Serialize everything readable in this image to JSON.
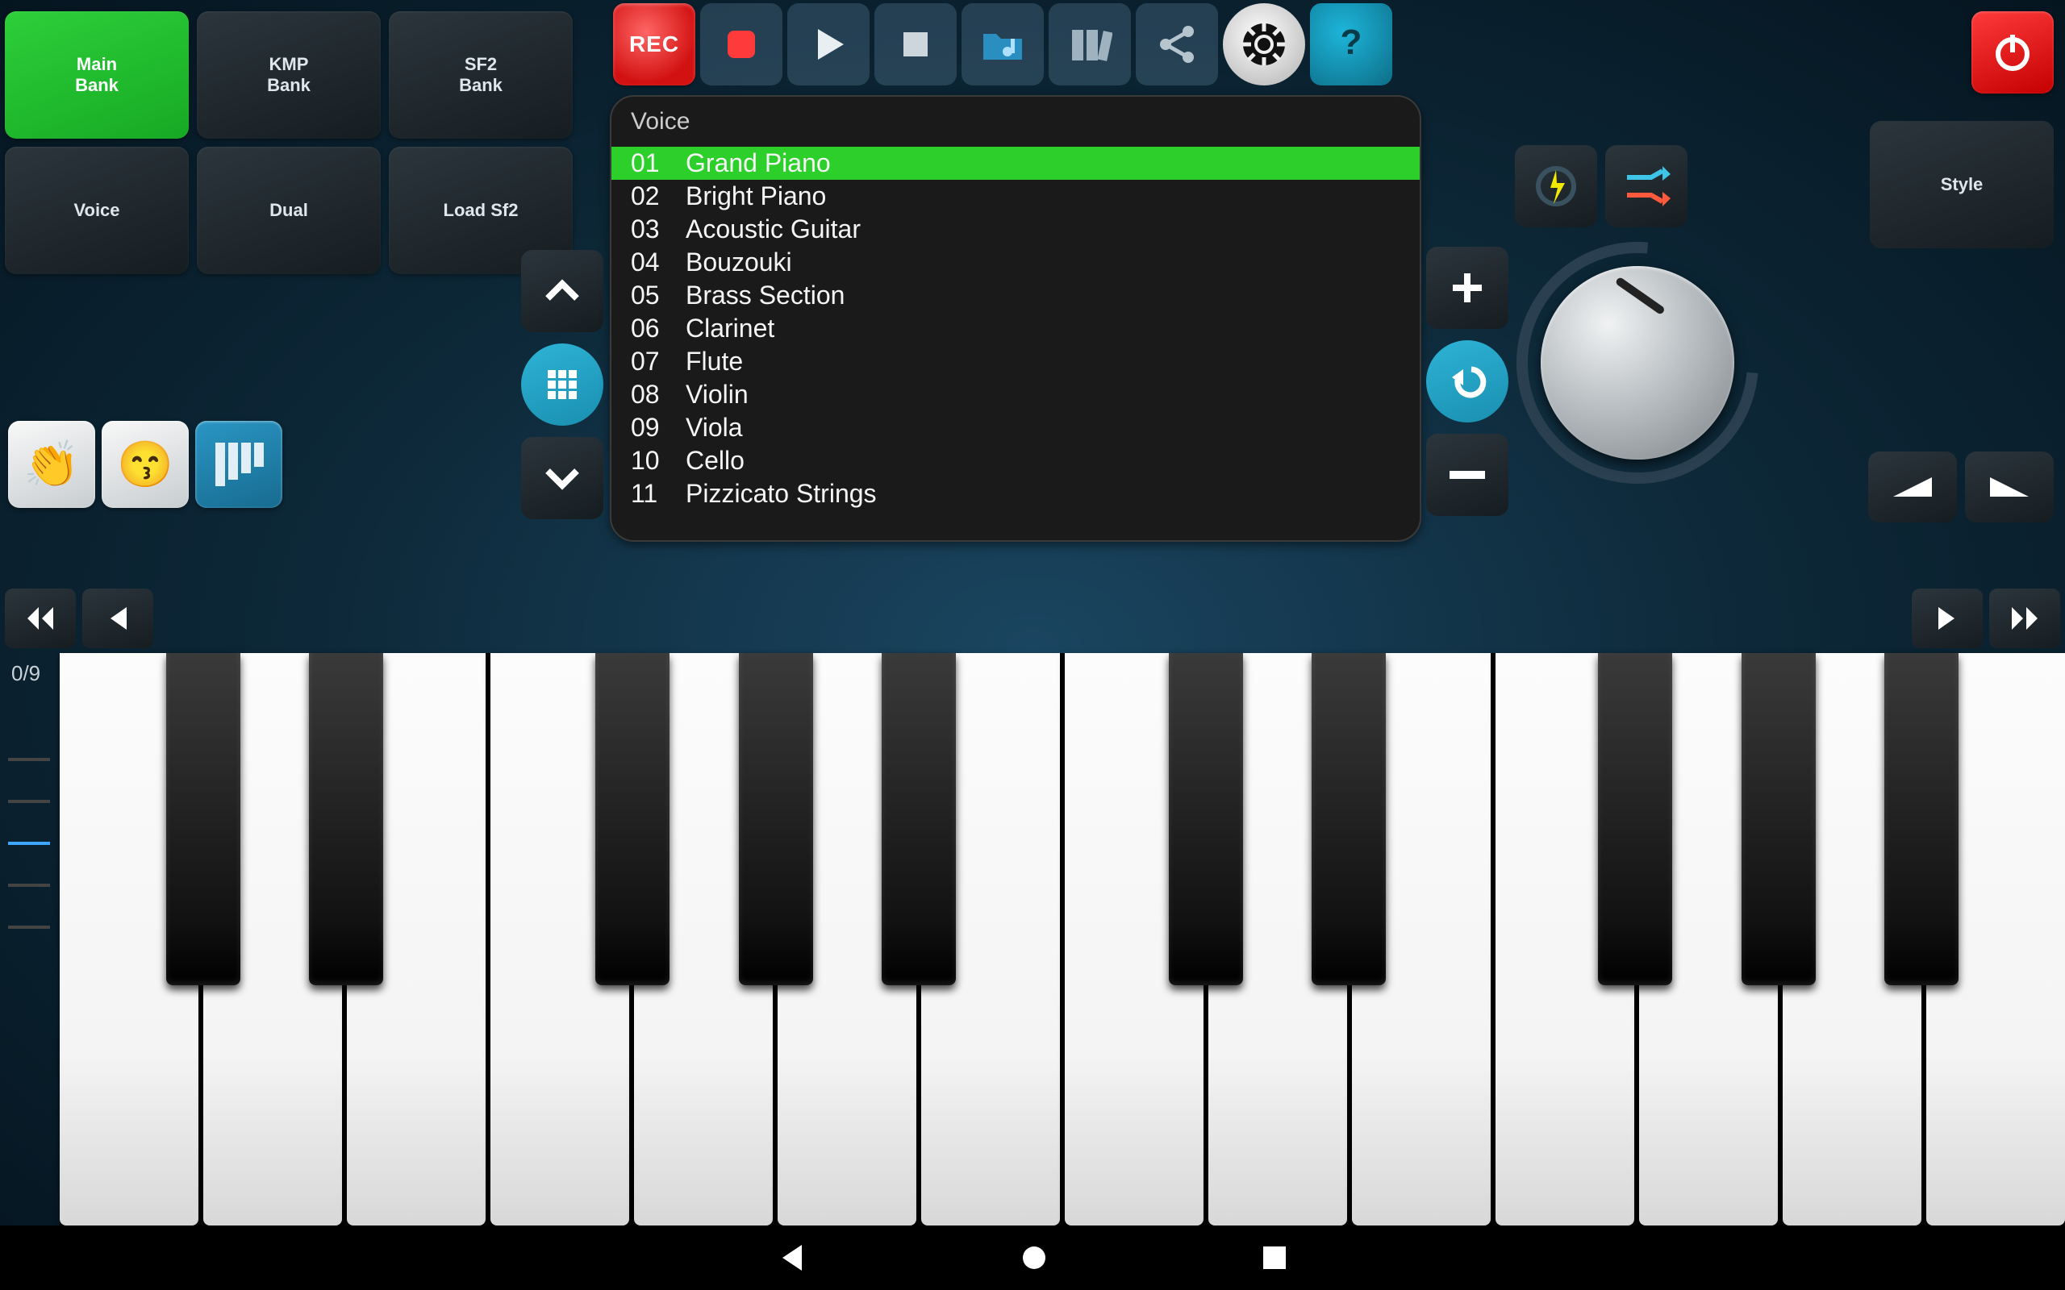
{
  "banks": [
    {
      "label": "Main\nBank",
      "active": true
    },
    {
      "label": "KMP\nBank",
      "active": false
    },
    {
      "label": "SF2\nBank",
      "active": false
    },
    {
      "label": "Voice",
      "active": false
    },
    {
      "label": "Dual",
      "active": false
    },
    {
      "label": "Load Sf2",
      "active": false
    }
  ],
  "toolbar": {
    "rec": "REC"
  },
  "style_label": "Style",
  "voice_panel": {
    "header": "Voice",
    "items": [
      {
        "num": "01",
        "name": "Grand Piano",
        "active": true
      },
      {
        "num": "02",
        "name": "Bright Piano",
        "active": false
      },
      {
        "num": "03",
        "name": "Acoustic Guitar",
        "active": false
      },
      {
        "num": "04",
        "name": "Bouzouki",
        "active": false
      },
      {
        "num": "05",
        "name": "Brass Section",
        "active": false
      },
      {
        "num": "06",
        "name": "Clarinet",
        "active": false
      },
      {
        "num": "07",
        "name": "Flute",
        "active": false
      },
      {
        "num": "08",
        "name": "Violin",
        "active": false
      },
      {
        "num": "09",
        "name": "Viola",
        "active": false
      },
      {
        "num": "10",
        "name": "Cello",
        "active": false
      },
      {
        "num": "11",
        "name": "Pizzicato Strings",
        "active": false
      }
    ]
  },
  "position": "0/9"
}
